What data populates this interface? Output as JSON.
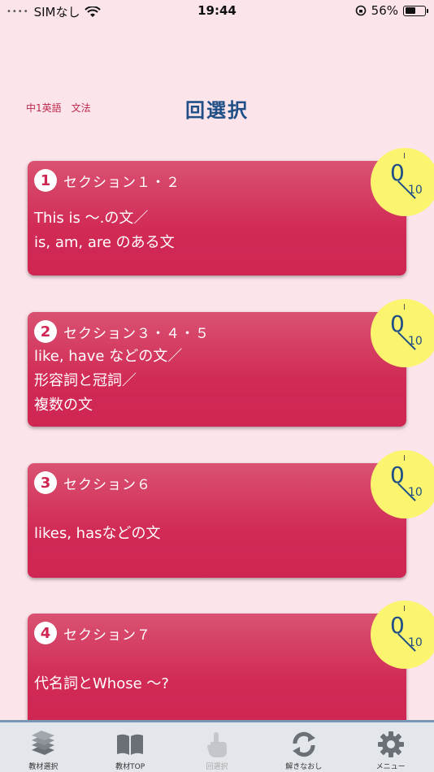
{
  "status": {
    "carrier": "SIMなし",
    "time": "19:44",
    "battery_percent": "56%",
    "battery_level": 0.56
  },
  "header": {
    "subject": "中1英語　文法",
    "title": "回選択"
  },
  "sections": [
    {
      "number": "1",
      "label": "セクション１・２",
      "lines": [
        "This is 〜.の文／",
        "is, am, are のある文"
      ],
      "score": "0",
      "total": "10"
    },
    {
      "number": "2",
      "label": "セクション３・４・５",
      "lines": [
        "like, have などの文／",
        "形容詞と冠詞／",
        "複数の文"
      ],
      "score": "0",
      "total": "10"
    },
    {
      "number": "3",
      "label": "セクション６",
      "lines": [
        "likes, hasなどの文"
      ],
      "score": "0",
      "total": "10"
    },
    {
      "number": "4",
      "label": "セクション７",
      "lines": [
        "代名詞とWhose 〜?"
      ],
      "score": "0",
      "total": "10"
    }
  ],
  "tabs": [
    {
      "label": "教材選択",
      "icon": "books-icon"
    },
    {
      "label": "教材TOP",
      "icon": "open-book-icon"
    },
    {
      "label": "回選択",
      "icon": "hand-pointer-icon"
    },
    {
      "label": "解きなおし",
      "icon": "refresh-icon"
    },
    {
      "label": "メニュー",
      "icon": "gear-icon"
    }
  ],
  "colors": {
    "background": "#fbe4ea",
    "card": "#cf2552",
    "score_badge": "#fbf46e",
    "title": "#1f4f86"
  }
}
